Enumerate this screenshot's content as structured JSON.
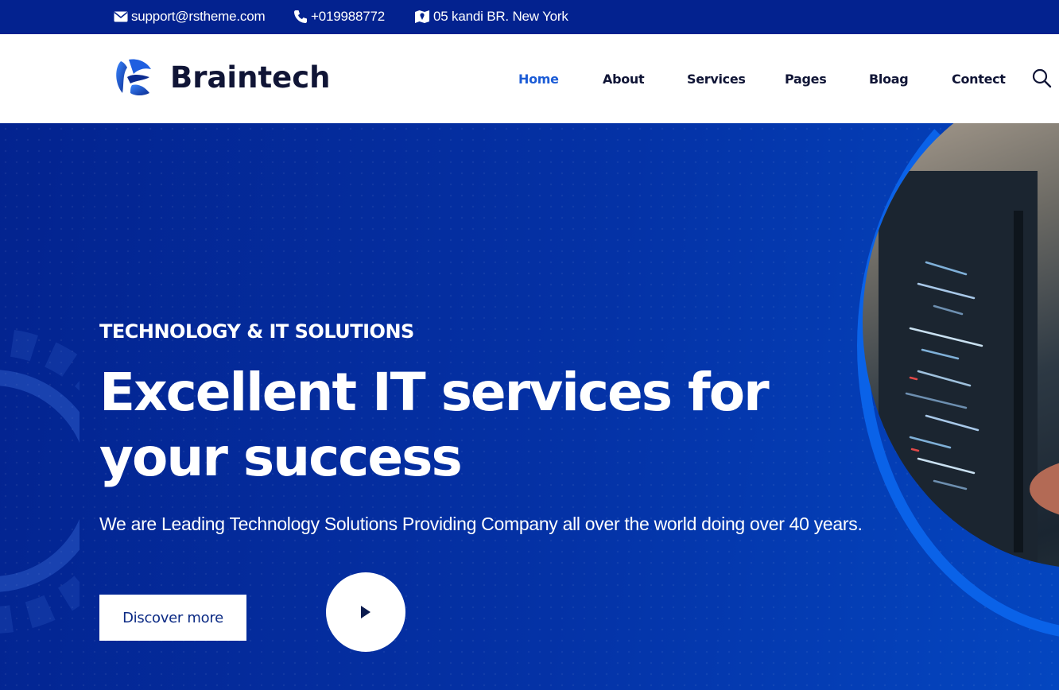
{
  "topbar": {
    "email": "support@rstheme.com",
    "phone": "+019988772",
    "address": "05 kandi BR. New York"
  },
  "header": {
    "logo_text": "Braintech",
    "nav": [
      {
        "label": "Home",
        "active": true
      },
      {
        "label": "About",
        "active": false
      },
      {
        "label": "Services",
        "active": false
      },
      {
        "label": "Pages",
        "active": false
      },
      {
        "label": "Bloag",
        "active": false
      },
      {
        "label": "Contect",
        "active": false
      }
    ],
    "search_icon": "search-icon"
  },
  "hero": {
    "subtitle": "TECHNOLOGY & IT SOLUTIONS",
    "title": "Excellent IT services for your success",
    "description": "We are Leading Technology Solutions Providing Company all over the world doing over 40 years.",
    "cta_label": "Discover more",
    "play_icon": "play-icon"
  },
  "colors": {
    "topbar_bg": "#03228f",
    "hero_bg": "#0432a6",
    "accent_blue": "#1c5cd6",
    "dark_text": "#101536"
  }
}
